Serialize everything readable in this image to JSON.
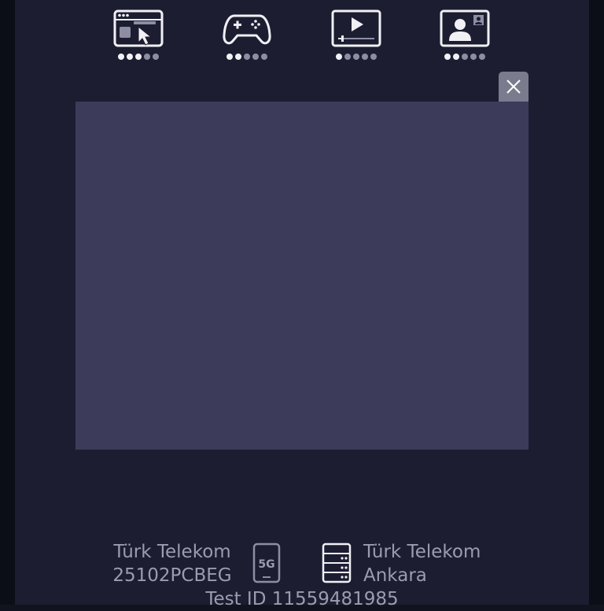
{
  "metrics": [
    {
      "name": "browsing",
      "icon": "browser-cursor-icon",
      "level": 3,
      "max": 5
    },
    {
      "name": "gaming",
      "icon": "gamepad-icon",
      "level": 2,
      "max": 5
    },
    {
      "name": "streaming",
      "icon": "video-play-icon",
      "level": 1,
      "max": 5
    },
    {
      "name": "video-call",
      "icon": "video-call-icon",
      "level": 2,
      "max": 5
    }
  ],
  "close_icon": "close-icon",
  "client": {
    "isp": "Türk Telekom",
    "id": "25102PCBEG",
    "network": "5G"
  },
  "server": {
    "isp": "Türk Telekom",
    "city": "Ankara"
  },
  "test": {
    "label": "Test ID 11559481985"
  },
  "colors": {
    "background": "#1c1d31",
    "panel": "#3c3b5a",
    "close_button": "#7a7b8c",
    "dot_active": "#f2f2f6",
    "dot_inactive": "#8d8ea3",
    "text": "#9b9cb0"
  }
}
